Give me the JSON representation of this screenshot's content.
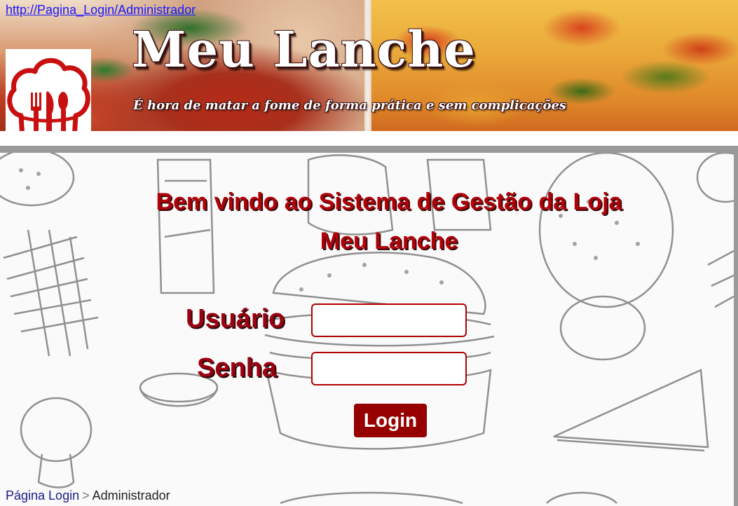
{
  "address_bar": {
    "url": "http://Pagina_Login/Administrador"
  },
  "header": {
    "title": "Meu Lanche",
    "slogan": "É hora de matar a fome de forma prática e sem complicações",
    "logo_icon": "chef-hat-cutlery-icon"
  },
  "login": {
    "welcome_line1": "Bem vindo ao Sistema de Gestão da Loja",
    "welcome_line2": "Meu Lanche",
    "user_label": "Usuário",
    "user_value": "",
    "password_label": "Senha",
    "password_value": "",
    "submit_label": "Login"
  },
  "breadcrumb": {
    "items": [
      "Página Login",
      "Administrador"
    ],
    "separator": ">"
  },
  "colors": {
    "accent": "#9a0010",
    "button": "#960000",
    "link": "#1a1aff",
    "panel_border": "#9a9a9a"
  }
}
